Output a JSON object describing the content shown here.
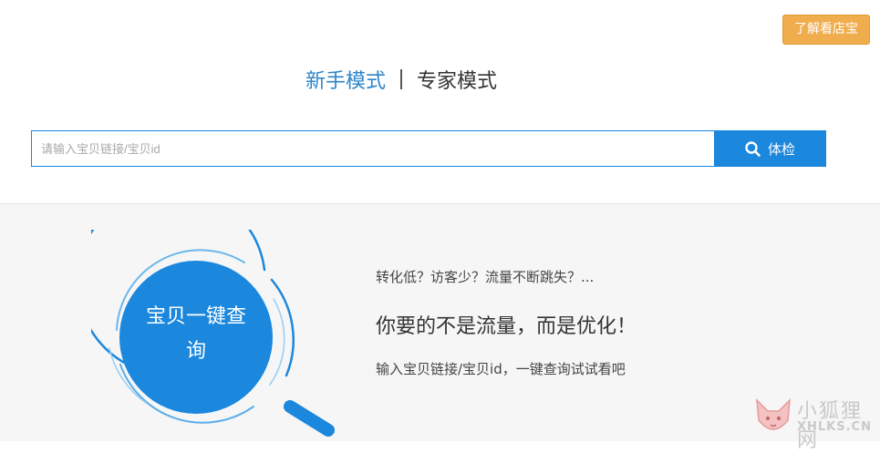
{
  "header": {
    "learn_button": "了解看店宝"
  },
  "modes": {
    "novice": "新手模式",
    "expert": "专家模式",
    "active": "novice"
  },
  "search": {
    "placeholder": "请输入宝贝链接/宝贝id",
    "value": "",
    "button_label": "体检",
    "button_icon": "search-icon"
  },
  "promo": {
    "circle_title": "宝贝一键查询",
    "line1": "转化低？访客少？流量不断跳失？...",
    "line2": "你要的不是流量，而是优化！",
    "line3": "输入宝贝链接/宝贝id，一键查询试试看吧"
  },
  "watermark": {
    "title": "小狐狸网",
    "subtitle": "XHLKS.CN",
    "icon": "fox-logo-icon"
  },
  "colors": {
    "accent": "#1b87dd",
    "active_tab": "#2f86c8",
    "learn_button": "#f0ad4e",
    "bottom_bg": "#f6f6f6"
  }
}
